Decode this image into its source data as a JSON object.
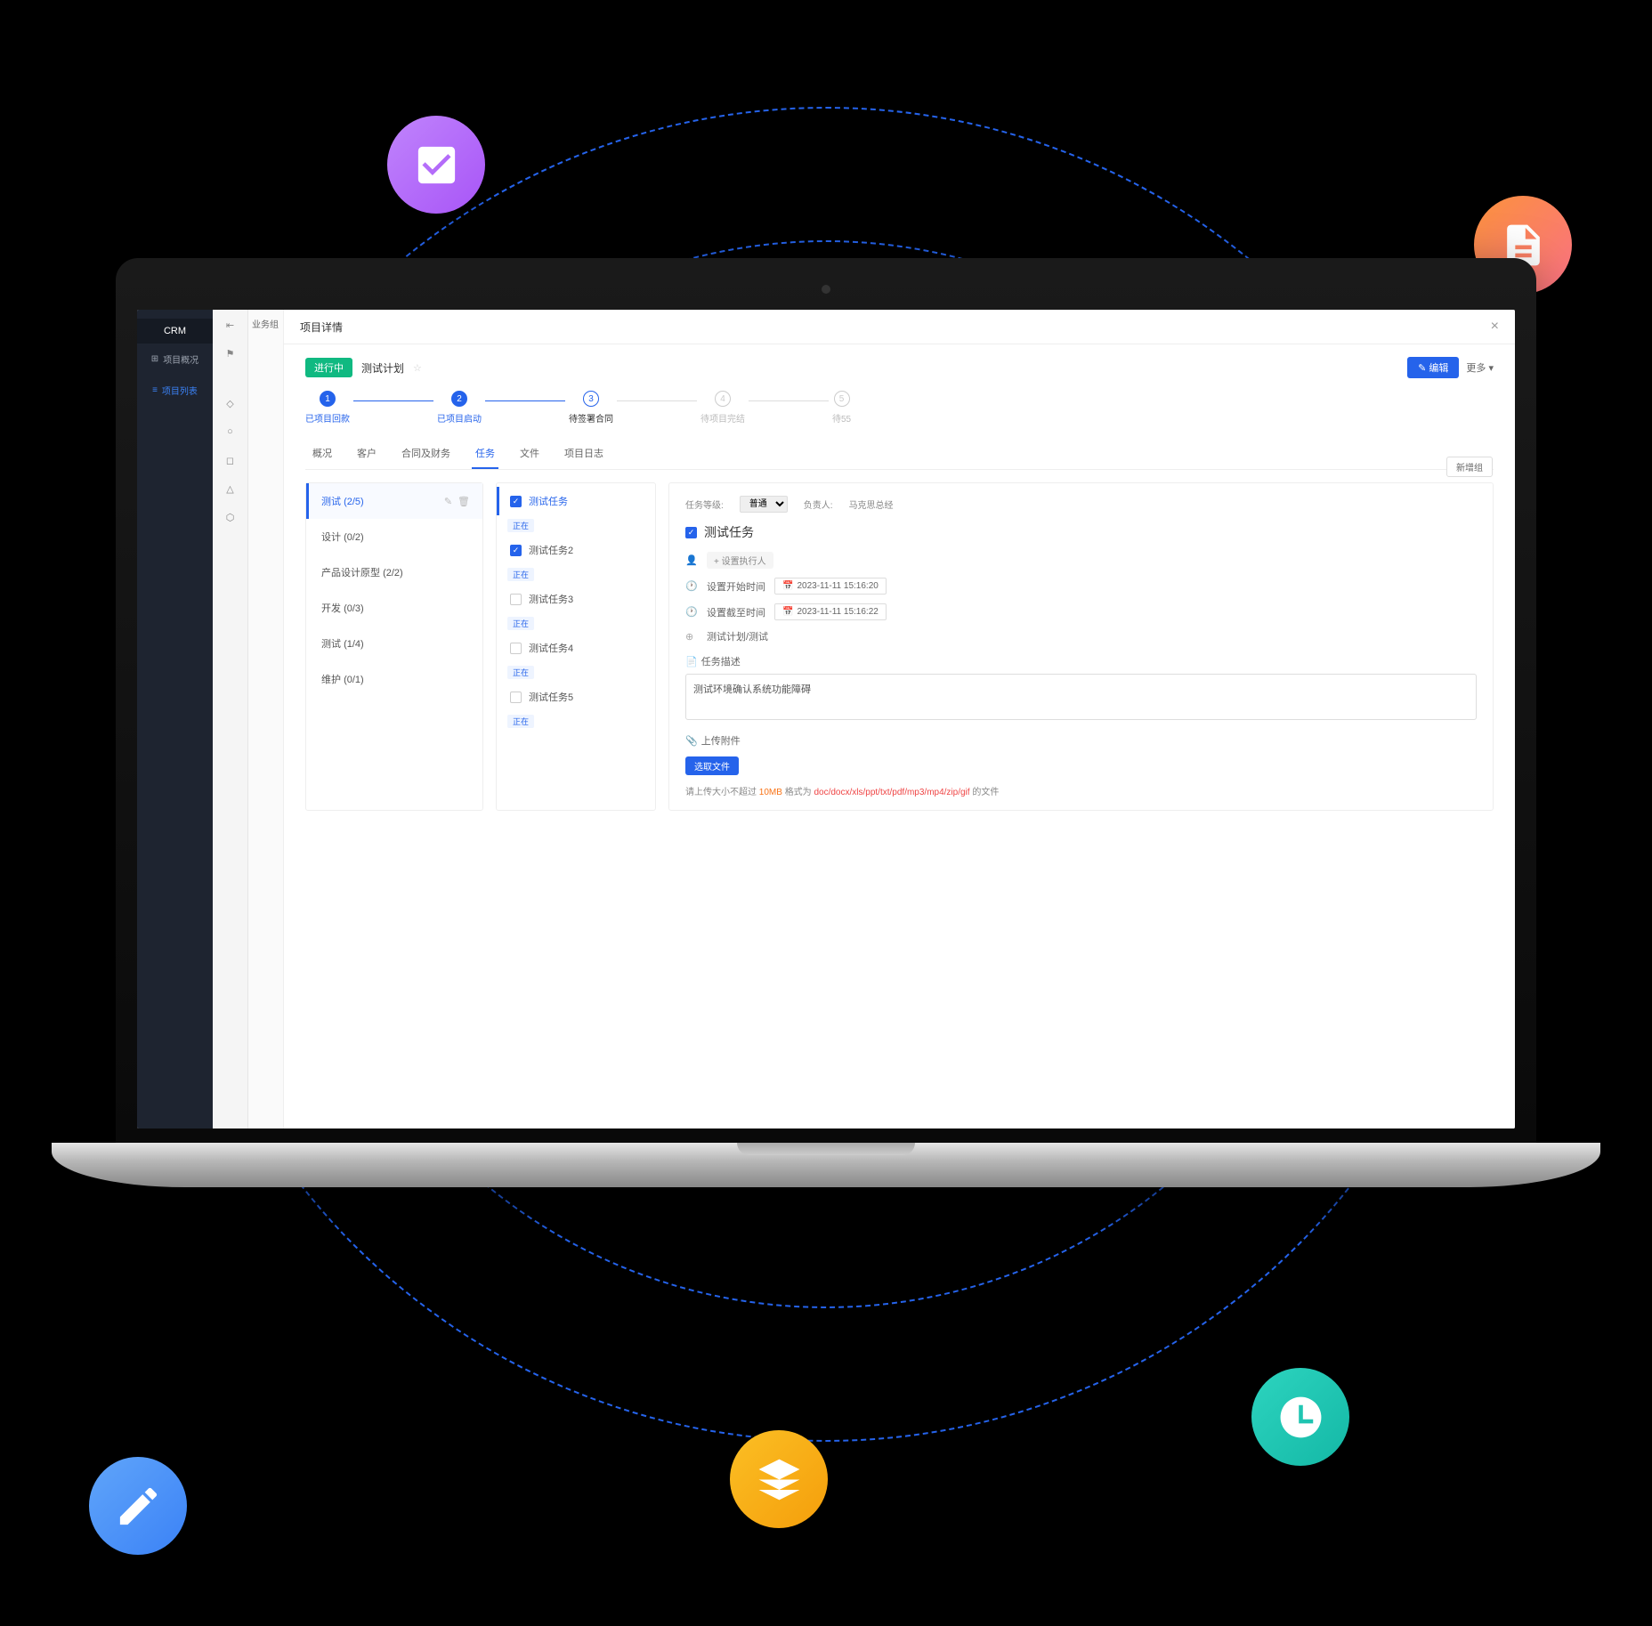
{
  "sidebar": {
    "brand": "CRM",
    "items": [
      {
        "icon": "dashboard",
        "label": "项目概况"
      },
      {
        "icon": "list",
        "label": "项目列表"
      }
    ]
  },
  "secondary_header": "业务组",
  "modal": {
    "title": "项目详情",
    "status_badge": "进行中",
    "plan_name": "测试计划",
    "edit_btn": "✎ 编辑",
    "more_btn": "更多 ▾",
    "close": "×"
  },
  "steps": [
    {
      "num": "1",
      "label": "已项目回款",
      "state": "done"
    },
    {
      "num": "2",
      "label": "已项目启动",
      "state": "done"
    },
    {
      "num": "3",
      "label": "待签署合同",
      "state": "current"
    },
    {
      "num": "4",
      "label": "待项目完结",
      "state": "inactive"
    },
    {
      "num": "5",
      "label": "待55",
      "state": "inactive"
    }
  ],
  "tabs": [
    "概况",
    "客户",
    "合同及财务",
    "任务",
    "文件",
    "项目日志"
  ],
  "active_tab": "任务",
  "groups": [
    {
      "name": "测试",
      "count": "(2/5)",
      "active": true
    },
    {
      "name": "设计",
      "count": "(0/2)"
    },
    {
      "name": "产品设计原型",
      "count": "(2/2)"
    },
    {
      "name": "开发",
      "count": "(0/3)"
    },
    {
      "name": "测试",
      "count": "(1/4)"
    },
    {
      "name": "维护",
      "count": "(0/1)"
    }
  ],
  "tasks": [
    {
      "label": "测试任务",
      "checked": true,
      "active": true,
      "tag": "正在"
    },
    {
      "label": "测试任务2",
      "checked": true,
      "tag": "正在"
    },
    {
      "label": "测试任务3",
      "checked": false,
      "tag": "正在"
    },
    {
      "label": "测试任务4",
      "checked": false,
      "tag": "正在"
    },
    {
      "label": "测试任务5",
      "checked": false,
      "tag": "正在"
    }
  ],
  "detail": {
    "new_group_btn": "新增组",
    "meta_priority_label": "任务等级:",
    "meta_priority_value": "普通",
    "meta_owner_label": "负责人:",
    "meta_owner_value": "马克思总经",
    "title": "测试任务",
    "add_collaborator": "+ 设置执行人",
    "start_label": "设置开始时间",
    "start_value": "2023-11-11 15:16:20",
    "end_label": "设置截至时间",
    "end_value": "2023-11-11 15:16:22",
    "plan_ref": "测试计划/测试",
    "desc_label": "任务描述",
    "desc_value": "测试环境确认系统功能障碍",
    "attach_label": "上传附件",
    "select_file_btn": "选取文件",
    "hint_prefix": "请上传大小不超过",
    "hint_size": "10MB",
    "hint_mid": "格式为",
    "hint_formats": "doc/docx/xls/ppt/txt/pdf/mp3/mp4/zip/gif",
    "hint_suffix": "的文件"
  }
}
